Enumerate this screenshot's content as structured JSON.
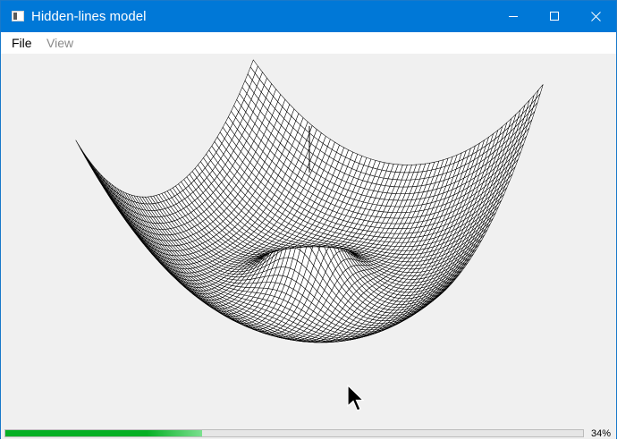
{
  "window": {
    "title": "Hidden-lines model",
    "app_icon": "app-window-icon",
    "controls": {
      "minimize": "minimize-icon",
      "maximize": "maximize-icon",
      "close": "close-icon"
    },
    "accent_color": "#0078d7"
  },
  "menu": {
    "items": [
      {
        "label": "File",
        "enabled": true
      },
      {
        "label": "View",
        "enabled": false
      }
    ]
  },
  "status": {
    "progress_percent": 34,
    "progress_text": "34%",
    "progress_color": "#06b025"
  },
  "cursor": {
    "icon": "mouse-pointer-icon"
  }
}
